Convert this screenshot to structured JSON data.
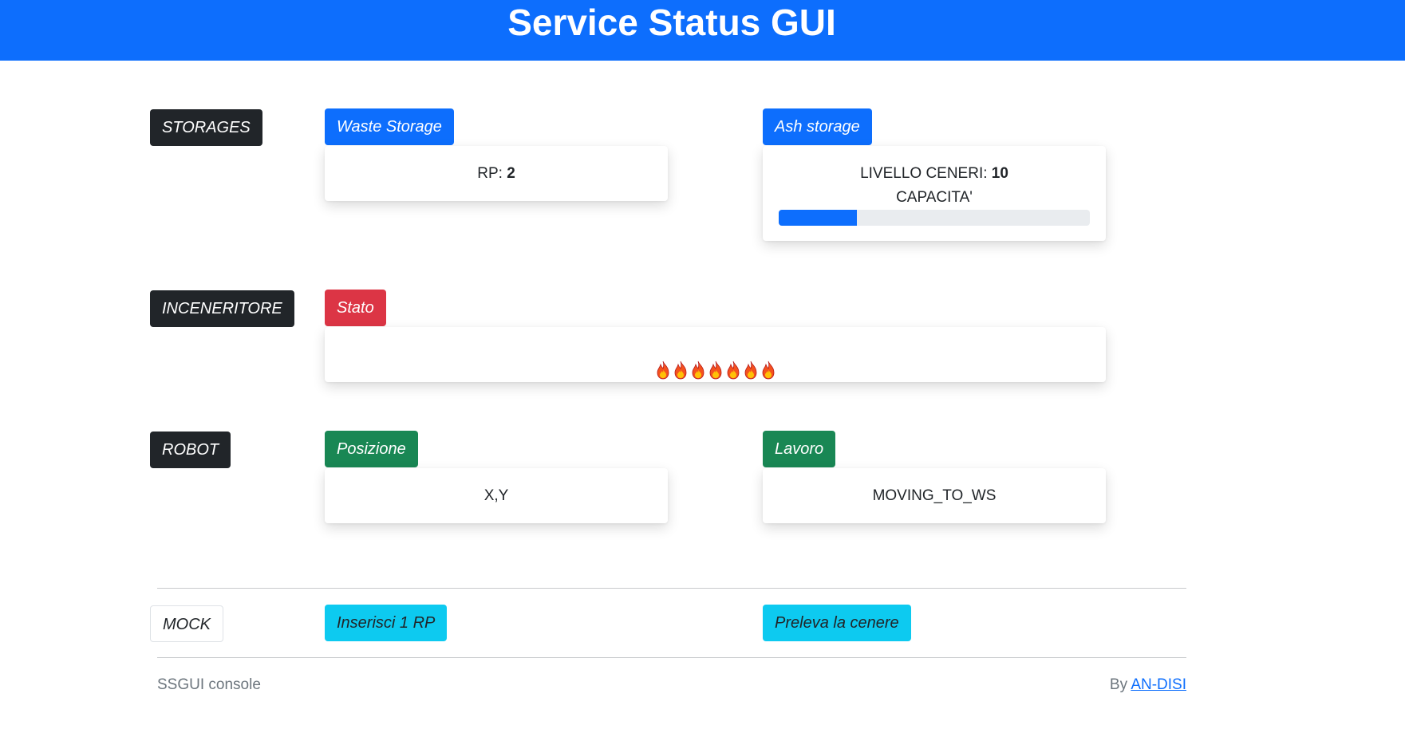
{
  "header": {
    "title": "Service Status GUI"
  },
  "sections": {
    "storages": {
      "label": "STORAGES",
      "waste": {
        "badge": "Waste Storage",
        "rp_label": "RP:",
        "rp_value": "2"
      },
      "ash": {
        "badge": "Ash storage",
        "level_label": "LIVELLO CENERI:",
        "level_value": "10",
        "capacity_label": "CAPACITA'",
        "capacity_fraction": 0.25
      }
    },
    "inceneritore": {
      "label": "INCENERITORE",
      "stato_badge": "Stato",
      "flame_count": 7,
      "flame_icon": "fire-icon"
    },
    "robot": {
      "label": "ROBOT",
      "posizione_badge": "Posizione",
      "posizione_value": "X,Y",
      "lavoro_badge": "Lavoro",
      "lavoro_value": "MOVING_TO_WS"
    },
    "mock": {
      "label": "MOCK",
      "insert_button": "Inserisci 1 RP",
      "withdraw_button": "Preleva la cenere"
    }
  },
  "footer": {
    "left": "SSGUI console",
    "by": "By",
    "link": "AN-DISI"
  },
  "colors": {
    "primary": "#0d6efd",
    "dark": "#212529",
    "danger": "#dc3545",
    "success": "#198754",
    "info": "#0dcaf0",
    "progress_track": "#e9ecef"
  }
}
